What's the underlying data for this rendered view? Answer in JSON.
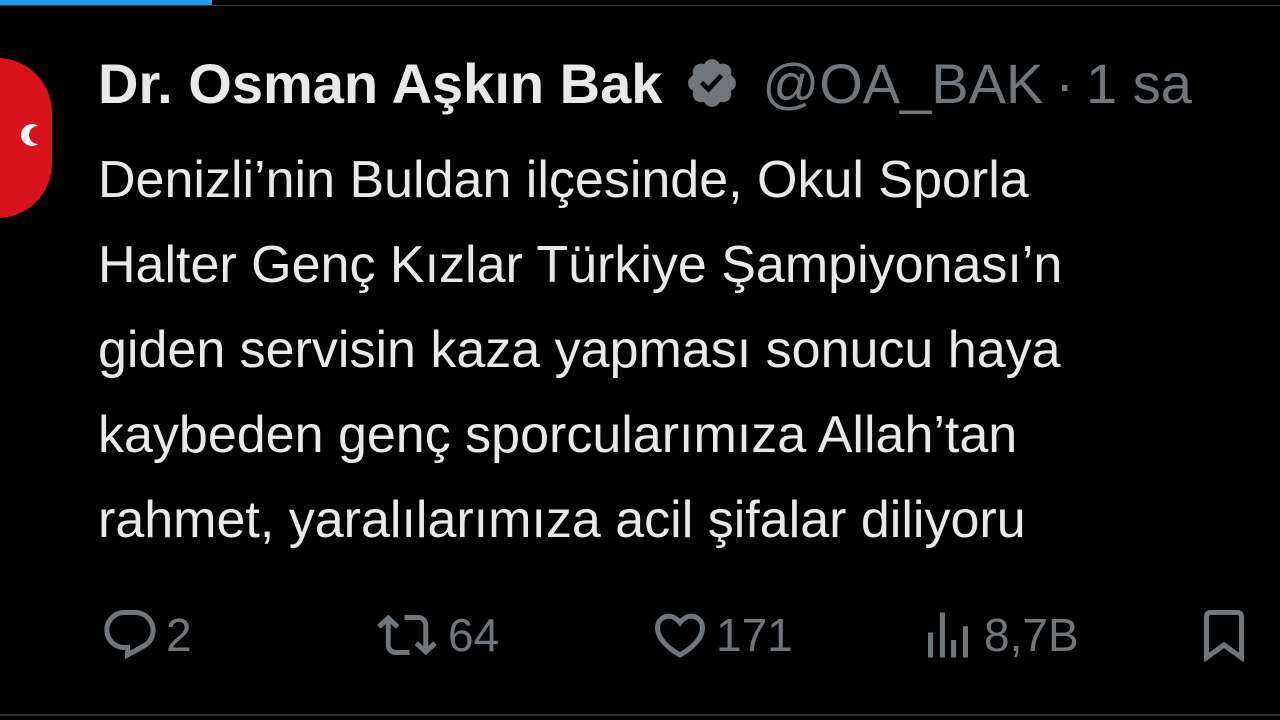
{
  "tweet": {
    "display_name": "Dr. Osman Aşkın Bak",
    "handle": "@OA_BAK",
    "separator": "·",
    "time": "1 sa",
    "lines": [
      "Denizli’nin Buldan ilçesinde, Okul Sporla",
      "Halter Genç Kızlar Türkiye Şampiyonası’n",
      "giden servisin kaza yapması sonucu haya",
      "kaybeden genç sporcularımıza Allah’tan",
      "rahmet, yaralılarımıza acil şifalar diliyoru"
    ]
  },
  "actions": {
    "reply_count": "2",
    "retweet_count": "64",
    "like_count": "171",
    "views_count": "8,7B"
  },
  "icons": {
    "verified": "verified-badge-icon",
    "reply": "reply-icon",
    "retweet": "retweet-icon",
    "like": "heart-icon",
    "views": "views-icon",
    "bookmark": "bookmark-icon"
  },
  "colors": {
    "background": "#000000",
    "text": "#e7e9ea",
    "secondary": "#71767b",
    "accent": "#1d9bf0"
  }
}
